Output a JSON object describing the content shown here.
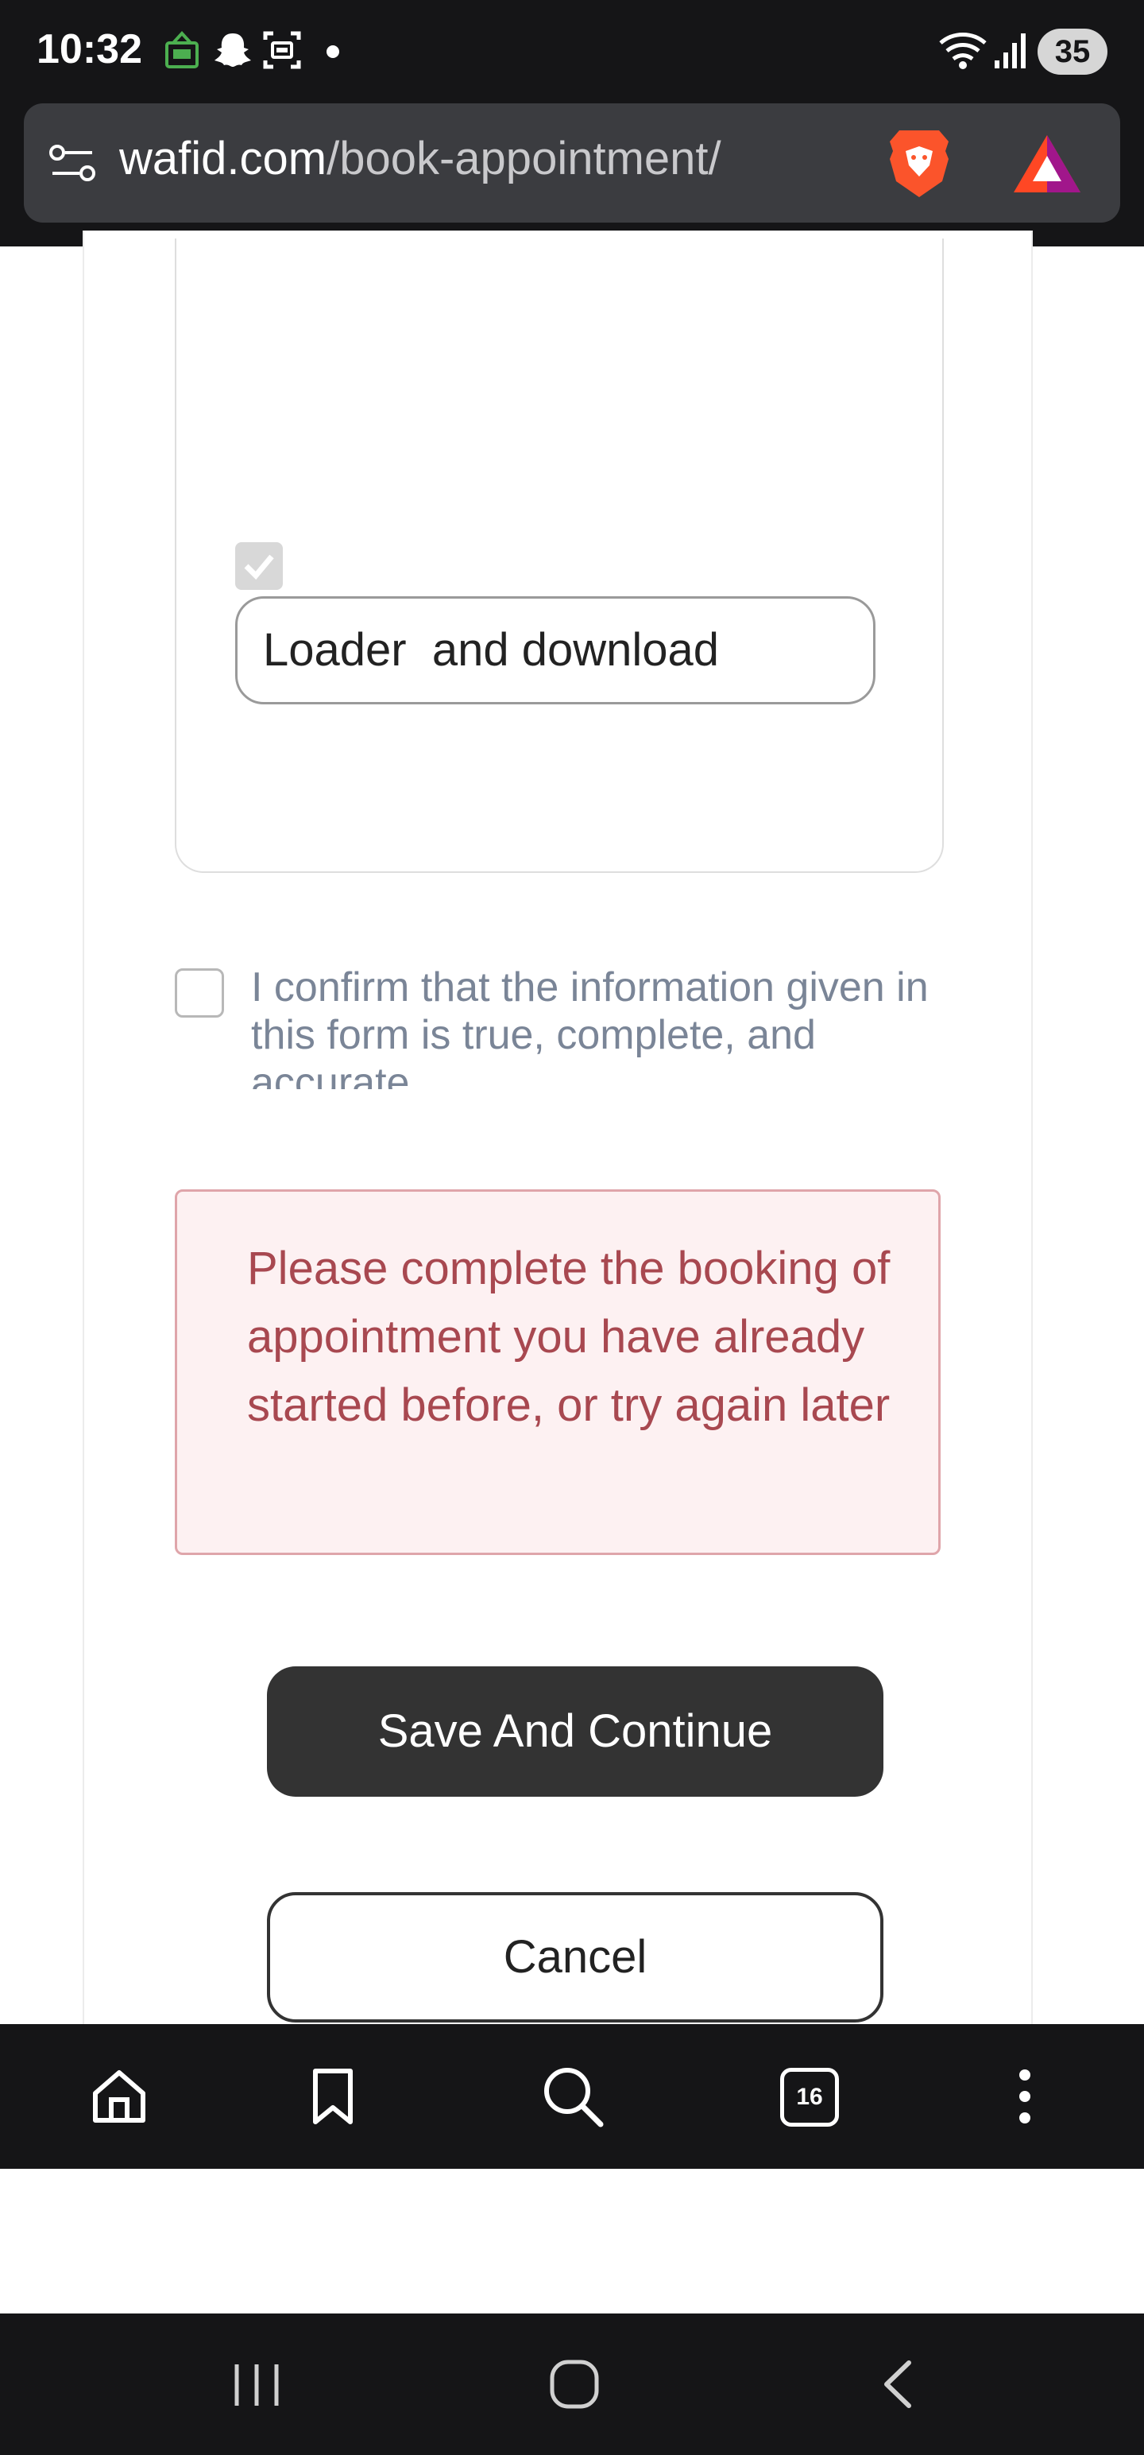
{
  "status_bar": {
    "time": "10:32",
    "battery": "35",
    "icons": [
      "app-notification-icon",
      "snapchat-icon",
      "screenshot-icon",
      "dot-icon",
      "wifi-icon",
      "signal-icon"
    ]
  },
  "browser": {
    "url_domain": "wafid.com",
    "url_path": "/book-appointment/",
    "icons": [
      "site-settings-icon",
      "brave-shields-icon",
      "brave-rewards-icon"
    ]
  },
  "form": {
    "occupation_value": "Loader  and download",
    "confirm_text": "I confirm that the information given in this form is true, complete, and accurate",
    "error_message": "Please complete the booking of appointment you have already started before, or try again later",
    "save_label": "Save And Continue",
    "cancel_label": "Cancel"
  },
  "toolbar": {
    "tabs_count": "16",
    "icons": [
      "home-icon",
      "bookmark-icon",
      "search-icon",
      "tabs-icon",
      "more-icon"
    ]
  },
  "nav_bar": {
    "icons": [
      "recent-apps-icon",
      "home-nav-icon",
      "back-icon"
    ]
  },
  "colors": {
    "error_text": "#a84850",
    "error_border": "#dfa5aa",
    "error_bg": "#fdf1f2",
    "primary_button": "#333333",
    "confirm_text": "#7a8597"
  }
}
